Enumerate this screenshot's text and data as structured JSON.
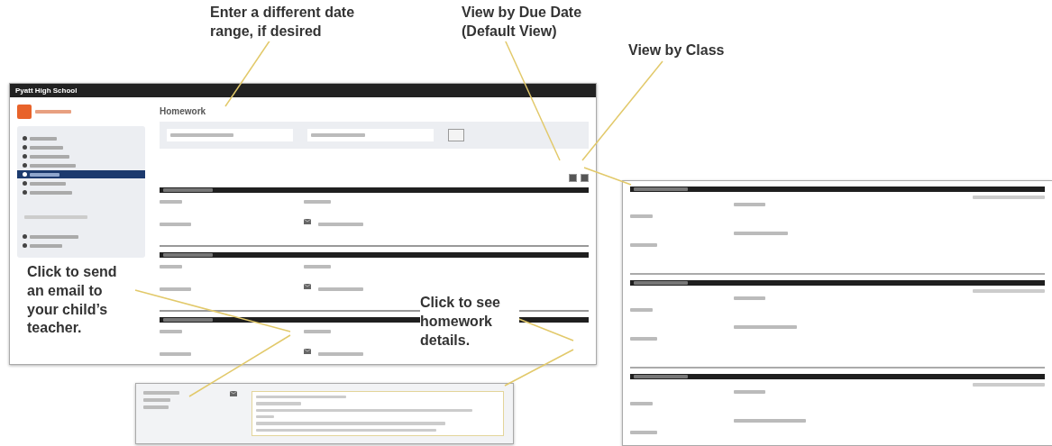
{
  "callouts": [
    {
      "text": "Enter a different date range, if desired"
    },
    {
      "text": "View by Due Date (Default View)"
    },
    {
      "text": "View by Class"
    },
    {
      "text": "Click to send an email to your child’s teacher."
    },
    {
      "text": "Click to see homework details."
    }
  ],
  "app": {
    "title": "Pyatt High School",
    "heading": "Homework",
    "sidebar_items": [
      {
        "selected": false
      },
      {
        "selected": false
      },
      {
        "selected": false
      },
      {
        "selected": false
      },
      {
        "selected": true
      },
      {
        "selected": false
      },
      {
        "selected": false
      },
      {
        "selected": false
      },
      {
        "selected": false
      }
    ]
  }
}
